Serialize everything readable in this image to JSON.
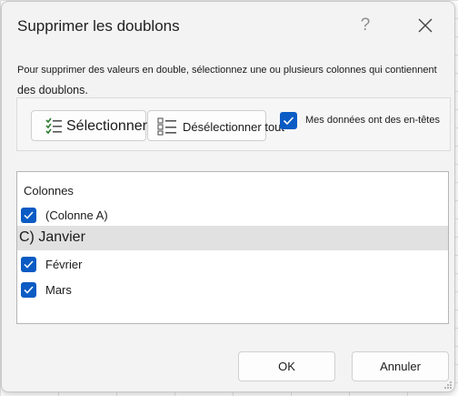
{
  "dialog": {
    "title": "Supprimer les doublons",
    "help_glyph": "?",
    "description_line1": "Pour supprimer des valeurs en double, sélectionnez une ou plusieurs colonnes qui contiennent",
    "description_line2": "des doublons."
  },
  "options": {
    "select_all_label": "Sélectionner tout",
    "deselect_all_label": "Désélectionner tout",
    "headers_checkbox_label": "Mes données ont des en-têtes",
    "headers_checked": true
  },
  "columns": {
    "header": "Colonnes",
    "items": [
      {
        "label": "(Colonne A)",
        "checked": true,
        "has_checkbox": true
      },
      {
        "label": "C) Janvier",
        "checked": false,
        "has_checkbox": false,
        "highlighted": true
      },
      {
        "label": "Février",
        "checked": true,
        "has_checkbox": true
      },
      {
        "label": "Mars",
        "checked": true,
        "has_checkbox": true
      }
    ]
  },
  "footer": {
    "ok_label": "OK",
    "cancel_label": "Annuler"
  },
  "icons": {
    "close": "close-icon",
    "select_all": "select-all-icon",
    "deselect_all": "deselect-all-icon",
    "checkbox": "checkmark-icon",
    "resize": "resize-grip-icon"
  },
  "colors": {
    "accent": "#0a5bc4",
    "dialog_bg": "#f3f3f3",
    "highlight_row": "#e1e1e1"
  }
}
